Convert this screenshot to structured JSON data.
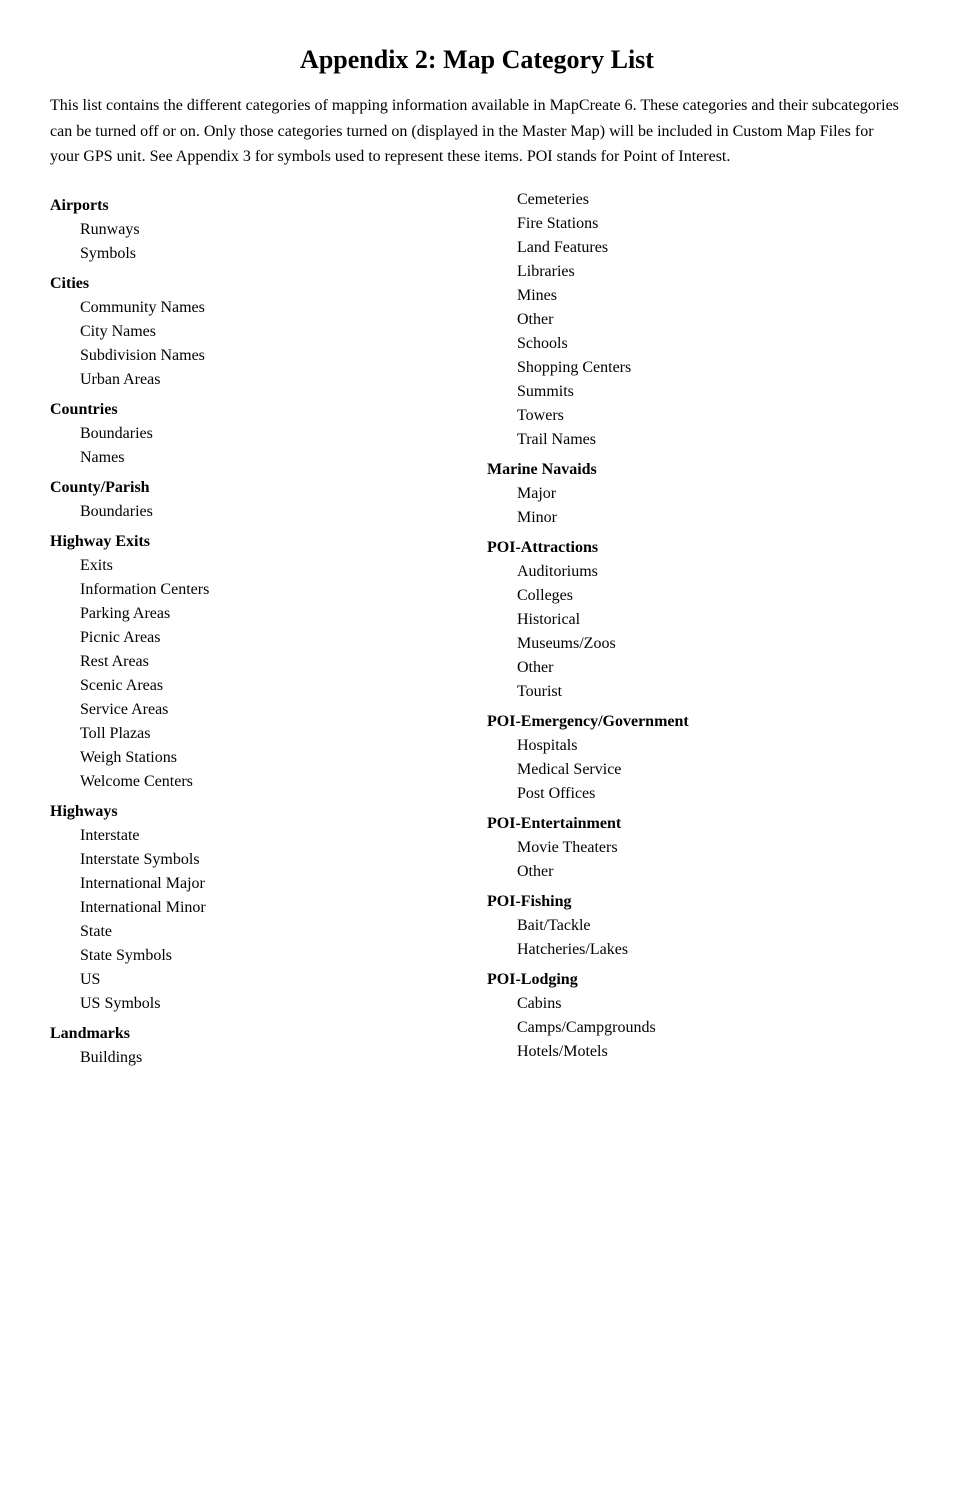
{
  "title": "Appendix 2: Map Category List",
  "intro": "This list contains the different categories of mapping information available in MapCreate 6. These categories and their subcategories can be turned off or on. Only those categories turned on (displayed in the Master Map) will be included in Custom Map Files for your GPS unit. See Appendix 3 for symbols used to represent these items. POI stands for Point of Interest.",
  "left_column": [
    {
      "type": "category",
      "text": "Airports"
    },
    {
      "type": "sub",
      "text": "Runways"
    },
    {
      "type": "sub",
      "text": "Symbols"
    },
    {
      "type": "category",
      "text": "Cities"
    },
    {
      "type": "sub",
      "text": "Community Names"
    },
    {
      "type": "sub",
      "text": "City Names"
    },
    {
      "type": "sub",
      "text": "Subdivision Names"
    },
    {
      "type": "sub",
      "text": "Urban Areas"
    },
    {
      "type": "category",
      "text": "Countries"
    },
    {
      "type": "sub",
      "text": "Boundaries"
    },
    {
      "type": "sub",
      "text": "Names"
    },
    {
      "type": "category",
      "text": "County/Parish"
    },
    {
      "type": "sub",
      "text": "Boundaries"
    },
    {
      "type": "category",
      "text": "Highway Exits"
    },
    {
      "type": "sub",
      "text": "Exits"
    },
    {
      "type": "sub",
      "text": "Information Centers"
    },
    {
      "type": "sub",
      "text": "Parking Areas"
    },
    {
      "type": "sub",
      "text": "Picnic Areas"
    },
    {
      "type": "sub",
      "text": "Rest Areas"
    },
    {
      "type": "sub",
      "text": "Scenic Areas"
    },
    {
      "type": "sub",
      "text": "Service Areas"
    },
    {
      "type": "sub",
      "text": "Toll Plazas"
    },
    {
      "type": "sub",
      "text": "Weigh Stations"
    },
    {
      "type": "sub",
      "text": "Welcome Centers"
    },
    {
      "type": "category",
      "text": "Highways"
    },
    {
      "type": "sub",
      "text": "Interstate"
    },
    {
      "type": "sub",
      "text": "Interstate Symbols"
    },
    {
      "type": "sub",
      "text": "International Major"
    },
    {
      "type": "sub",
      "text": "International Minor"
    },
    {
      "type": "sub",
      "text": "State"
    },
    {
      "type": "sub",
      "text": "State Symbols"
    },
    {
      "type": "sub",
      "text": "US"
    },
    {
      "type": "sub",
      "text": "US Symbols"
    },
    {
      "type": "category",
      "text": "Landmarks"
    },
    {
      "type": "sub",
      "text": "Buildings"
    }
  ],
  "right_column": [
    {
      "type": "sub",
      "text": "Cemeteries"
    },
    {
      "type": "sub",
      "text": "Fire Stations"
    },
    {
      "type": "sub",
      "text": "Land Features"
    },
    {
      "type": "sub",
      "text": "Libraries"
    },
    {
      "type": "sub",
      "text": "Mines"
    },
    {
      "type": "sub",
      "text": "Other"
    },
    {
      "type": "sub",
      "text": "Schools"
    },
    {
      "type": "sub",
      "text": "Shopping Centers"
    },
    {
      "type": "sub",
      "text": "Summits"
    },
    {
      "type": "sub",
      "text": "Towers"
    },
    {
      "type": "sub",
      "text": "Trail Names"
    },
    {
      "type": "category",
      "text": "Marine Navaids"
    },
    {
      "type": "sub",
      "text": "Major"
    },
    {
      "type": "sub",
      "text": "Minor"
    },
    {
      "type": "category",
      "text": "POI-Attractions"
    },
    {
      "type": "sub",
      "text": "Auditoriums"
    },
    {
      "type": "sub",
      "text": "Colleges"
    },
    {
      "type": "sub",
      "text": "Historical"
    },
    {
      "type": "sub",
      "text": "Museums/Zoos"
    },
    {
      "type": "sub",
      "text": "Other"
    },
    {
      "type": "sub",
      "text": "Tourist"
    },
    {
      "type": "category",
      "text": "POI-Emergency/Government"
    },
    {
      "type": "sub",
      "text": "Hospitals"
    },
    {
      "type": "sub",
      "text": "Medical Service"
    },
    {
      "type": "sub",
      "text": "Post Offices"
    },
    {
      "type": "category",
      "text": "POI-Entertainment"
    },
    {
      "type": "sub",
      "text": "Movie Theaters"
    },
    {
      "type": "sub",
      "text": "Other"
    },
    {
      "type": "category",
      "text": "POI-Fishing"
    },
    {
      "type": "sub",
      "text": "Bait/Tackle"
    },
    {
      "type": "sub",
      "text": "Hatcheries/Lakes"
    },
    {
      "type": "category",
      "text": "POI-Lodging"
    },
    {
      "type": "sub",
      "text": "Cabins"
    },
    {
      "type": "sub",
      "text": "Camps/Campgrounds"
    },
    {
      "type": "sub",
      "text": "Hotels/Motels"
    }
  ]
}
